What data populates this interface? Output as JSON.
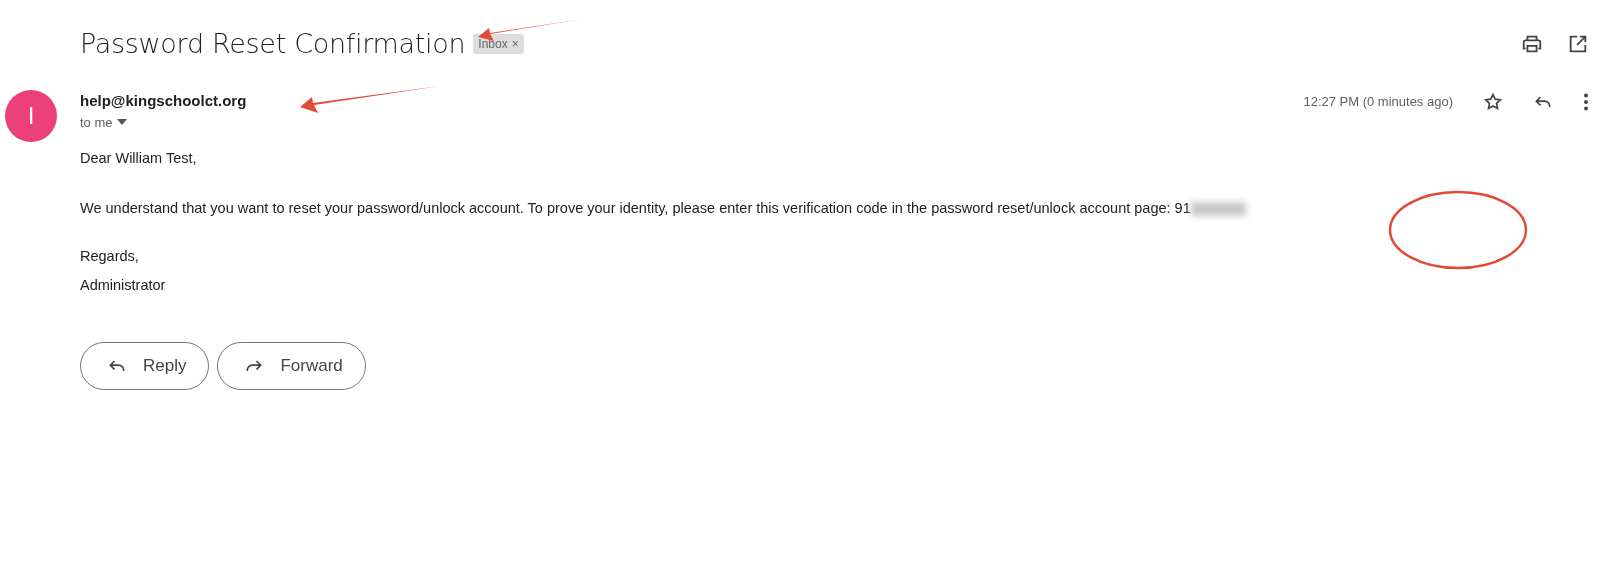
{
  "subject": "Password Reset Confirmation",
  "label": {
    "text": "Inbox",
    "close": "×"
  },
  "sender": {
    "initial": "I",
    "color": "#ec407a",
    "email": "help@kingschoolct.org",
    "recipient": "to me"
  },
  "time": "12:27 PM (0 minutes ago)",
  "body": [
    "Dear William Test,",
    "We understand that you want to reset your password/unlock account. To prove your identity, please enter this verification code in the password reset/unlock account page: 91"
  ],
  "signature": [
    "Regards,",
    "Administrator"
  ],
  "buttons": [
    {
      "kind": "reply",
      "label": "Reply"
    },
    {
      "kind": "forward",
      "label": "Forward"
    }
  ]
}
